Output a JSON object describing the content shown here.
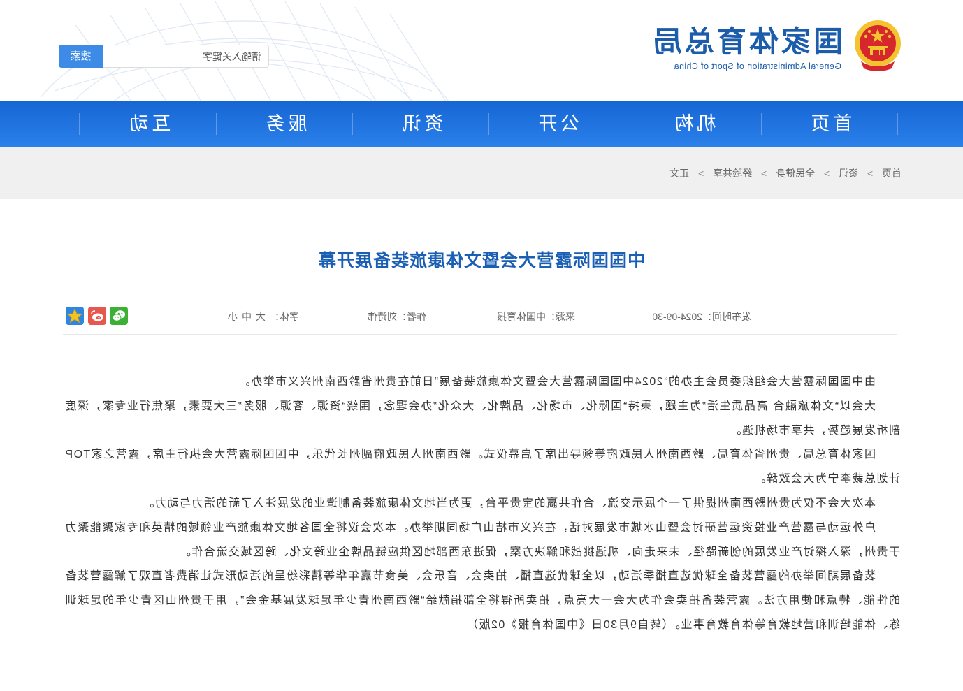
{
  "site": {
    "name": "国家体育总局",
    "name_en": "General Administration of Sport of China"
  },
  "search": {
    "placeholder": "请输入关键字",
    "button_label": "搜索"
  },
  "nav": {
    "items": [
      {
        "label": "首页"
      },
      {
        "label": "机构"
      },
      {
        "label": "公开"
      },
      {
        "label": "资讯"
      },
      {
        "label": "服务"
      },
      {
        "label": "互动"
      }
    ]
  },
  "breadcrumb": {
    "separator": ">",
    "items": [
      "首页",
      "资讯",
      "全民健身",
      "经验共享",
      "正文"
    ]
  },
  "article": {
    "title": "中国国际露营大会暨文体康旅装备展开幕",
    "meta": {
      "publish_label": "发布时间：",
      "publish_date": "2024-09-30",
      "source_label": "来源：",
      "source": "中国体育报",
      "author_label": "作者：",
      "author": "刘诗伟",
      "font_label": "字体：",
      "font_large": "大",
      "font_medium": "中",
      "font_small": "小"
    },
    "paragraphs": [
      "由中国国际露营大会组织委员会主办的“2024中国国际露营大会暨文体康旅装备展”日前在贵州省黔西南州兴义市举办。",
      "大会以“文体旅融合 高品质生活”为主题，秉持“国际化、市场化、品牌化、大众化”办会理念，围绕“资源、客源、服务”三大要素，聚焦行业专家，深度剖析发展趋势，共享市场机遇。",
      "国家体育总局、贵州省体育局、黔西南州人民政府等领导出席了启幕仪式。黔西南州人民政府副州长代乐，中国国际露营大会执行主席，露营之家TOP计划总裁李宁为大会致辞。",
      "本次大会不仅为贵州黔西南州提供了一个展示交流、合作共赢的宝贵平台，更为当地文体康旅装备制造业的发展注入了新的活力与动力。",
      "户外运动与露营产业投资运营研讨会暨山水城市发展对话，在兴义市桔山广场同期举办。本次会议将全国各地文体康旅产业领域的精英和专家聚能聚力于贵州，深入探讨产业发展的创新路径、未来走向、机遇挑战和解决方案，促进东西部地区供应链品牌企业跨文化、跨区域交流合作。",
      "装备展期间举办的露营装备全球优选直播季活动，以全球优选直播、拍卖会、音乐会、美食节嘉年华等精彩纷呈的活动形式让消费者直观了解露营装备的性能、特点和使用方法。露营装备拍卖会作为大会一大亮点，拍卖所得将全部捐献给“黔西南州青少年足球发展基金会”，用于贵州山区青少年的足球训练、体能培训和营地教育等体育教育事业。（转自9月30日《中国体育报》02版）"
    ]
  },
  "share": {
    "icons": [
      "wechat-icon",
      "weibo-icon",
      "qzone-icon"
    ]
  },
  "colors": {
    "brand_blue": "#1b5dab",
    "nav_blue": "#1f72de",
    "title_blue": "#1a5fb4",
    "search_button": "#3d8be6",
    "crumb_band": "#f0f0f0",
    "emblem_red": "#d6282c",
    "emblem_gold": "#f4c430"
  }
}
